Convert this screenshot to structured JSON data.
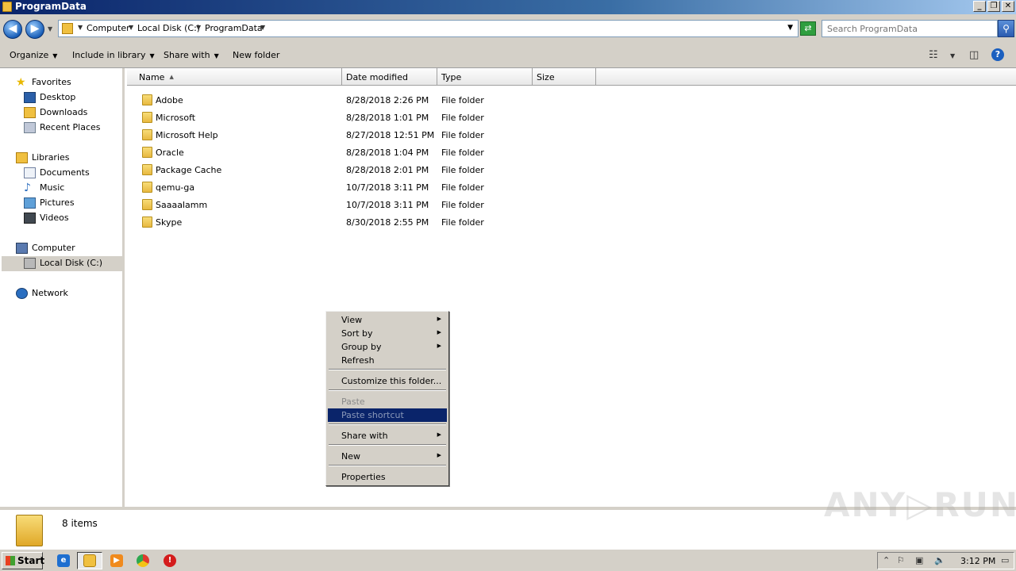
{
  "window": {
    "title": "ProgramData",
    "minimize": "_",
    "restore": "❐",
    "close": "✕"
  },
  "address": {
    "crumbs": [
      "Computer",
      "Local Disk (C:)",
      "ProgramData"
    ]
  },
  "search": {
    "placeholder": "Search ProgramData"
  },
  "toolbar": {
    "organize": "Organize",
    "include_in_library": "Include in library",
    "share_with": "Share with",
    "new_folder": "New folder"
  },
  "nav": {
    "favorites": "Favorites",
    "desktop": "Desktop",
    "downloads": "Downloads",
    "recent_places": "Recent Places",
    "libraries": "Libraries",
    "documents": "Documents",
    "music": "Music",
    "pictures": "Pictures",
    "videos": "Videos",
    "computer": "Computer",
    "local_disk": "Local Disk (C:)",
    "network": "Network"
  },
  "columns": {
    "name": "Name",
    "date_modified": "Date modified",
    "type": "Type",
    "size": "Size"
  },
  "files": [
    {
      "name": "Adobe",
      "date": "8/28/2018 2:26 PM",
      "type": "File folder"
    },
    {
      "name": "Microsoft",
      "date": "8/28/2018 1:01 PM",
      "type": "File folder"
    },
    {
      "name": "Microsoft Help",
      "date": "8/27/2018 12:51 PM",
      "type": "File folder"
    },
    {
      "name": "Oracle",
      "date": "8/28/2018 1:04 PM",
      "type": "File folder"
    },
    {
      "name": "Package Cache",
      "date": "8/28/2018 2:01 PM",
      "type": "File folder"
    },
    {
      "name": "qemu-ga",
      "date": "10/7/2018 3:11 PM",
      "type": "File folder"
    },
    {
      "name": "Saaaalamm",
      "date": "10/7/2018 3:11 PM",
      "type": "File folder"
    },
    {
      "name": "Skype",
      "date": "8/30/2018 2:55 PM",
      "type": "File folder"
    }
  ],
  "context_menu": {
    "view": "View",
    "sort_by": "Sort by",
    "group_by": "Group by",
    "refresh": "Refresh",
    "customize": "Customize this folder...",
    "paste": "Paste",
    "paste_shortcut": "Paste shortcut",
    "share_with": "Share with",
    "new": "New",
    "properties": "Properties"
  },
  "details": {
    "item_count": "8 items"
  },
  "watermark": "ANY▷RUN",
  "taskbar": {
    "start": "Start",
    "clock": "3:12 PM"
  },
  "colors": {
    "selection": "#0a246a",
    "chrome": "#d4d0c8",
    "folder": "#f0c040"
  }
}
